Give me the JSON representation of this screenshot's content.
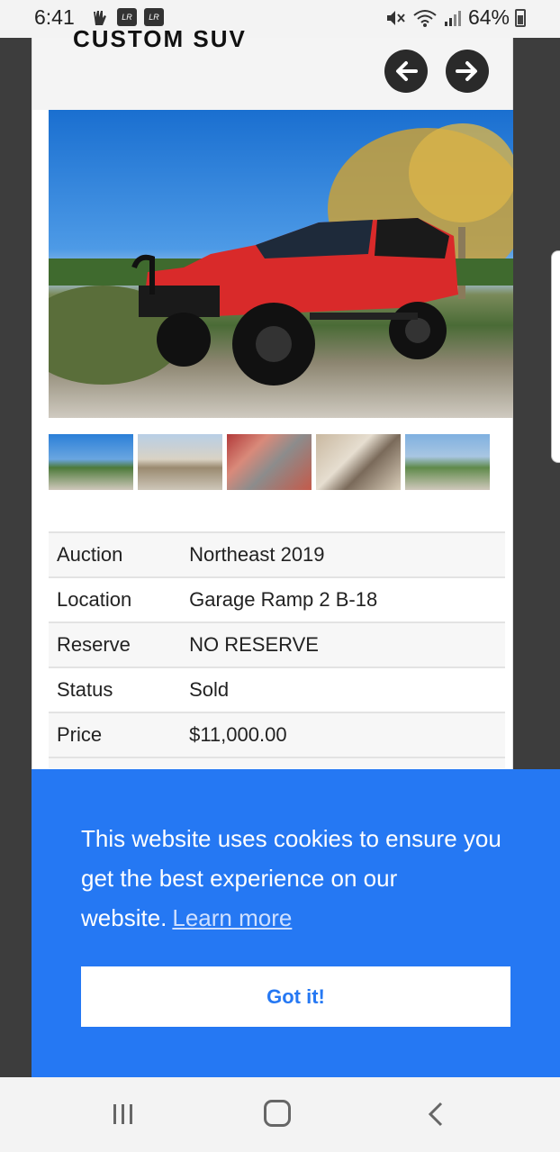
{
  "status_bar": {
    "time": "6:41",
    "notif_icons": [
      "LR",
      "LR"
    ],
    "battery": "64%"
  },
  "listing": {
    "title_fragment": "CUSTOM SUV"
  },
  "gallery": {
    "thumbnail_count": 5
  },
  "details": [
    {
      "label": "Auction",
      "value": "Northeast 2019"
    },
    {
      "label": "Location",
      "value": "Garage Ramp 2 B-18"
    },
    {
      "label": "Reserve",
      "value": "NO RESERVE"
    },
    {
      "label": "Status",
      "value": "Sold"
    },
    {
      "label": "Price",
      "value": "$11,000.00"
    }
  ],
  "cookie_banner": {
    "message": "This website uses cookies to ensure you get the best experience on our website.",
    "link_label": "Learn more",
    "button_label": "Got it!",
    "color": "#2578f3"
  }
}
